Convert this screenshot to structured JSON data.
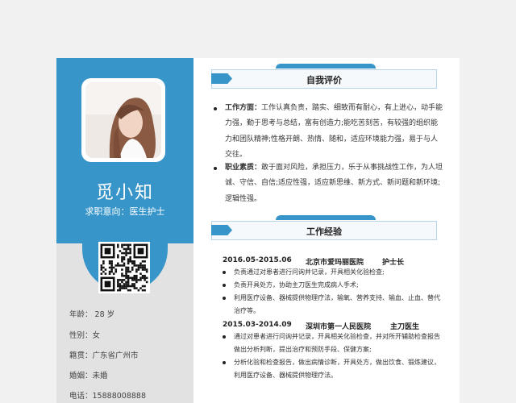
{
  "profile": {
    "name": "觅小知",
    "intent": "求职意向：医生护士",
    "info": [
      {
        "label": "年龄：",
        "value": " 28 岁"
      },
      {
        "label": "性别：",
        "value": "女"
      },
      {
        "label": "籍贯：",
        "value": "广东省广州市"
      },
      {
        "label": "婚姻：",
        "value": "未婚"
      },
      {
        "label": "电话：",
        "value": "15888008888"
      }
    ]
  },
  "self_eval": {
    "title": "自我评价",
    "items": [
      {
        "label": "工作方面：",
        "text": "工作认真负责，踏实、细致而有耐心，有上进心，动手能力强，勤于思考与总结，富有创造力;能吃苦刻苦，有较强的组织能力和团队精神;性格开朗、热情、随和，适应环境能力强，易于与人交往。"
      },
      {
        "label": "职业素质：",
        "text": "敢于面对风险，承担压力，乐于从事挑战性工作，为人坦诚、守信、自信;适应性强，适应新思维、新方式、新问题和新环境;逻辑性强。"
      }
    ]
  },
  "experience": {
    "title": "工作经验",
    "jobs": [
      {
        "date": "2016.05-2015.06",
        "company": "北京市爱玛丽医院",
        "role": "护士长",
        "bullets": [
          "负责通过对患者进行问询并记录，开具相关化验检查;",
          "负责开具处方，协助主刀医生完成病人手术;",
          "利用医疗设备、器械提供物理疗法，输氧、营养支持、输血、止血、替代治疗等。"
        ]
      },
      {
        "date": "2015.03-2014.09",
        "company": "深圳市第一人民医院",
        "role": "主刀医生",
        "bullets": [
          "通过对患者进行问询并记录，开具相关化验检查，并对所开辅助检查报告做出分析判断，提出治疗和预防手段、保健方案;",
          "分析化验和检查报告，做出病情诊断，开具处方，做出饮食、锻炼建议，利用医疗设备、器械提供物理疗法。"
        ]
      }
    ]
  }
}
